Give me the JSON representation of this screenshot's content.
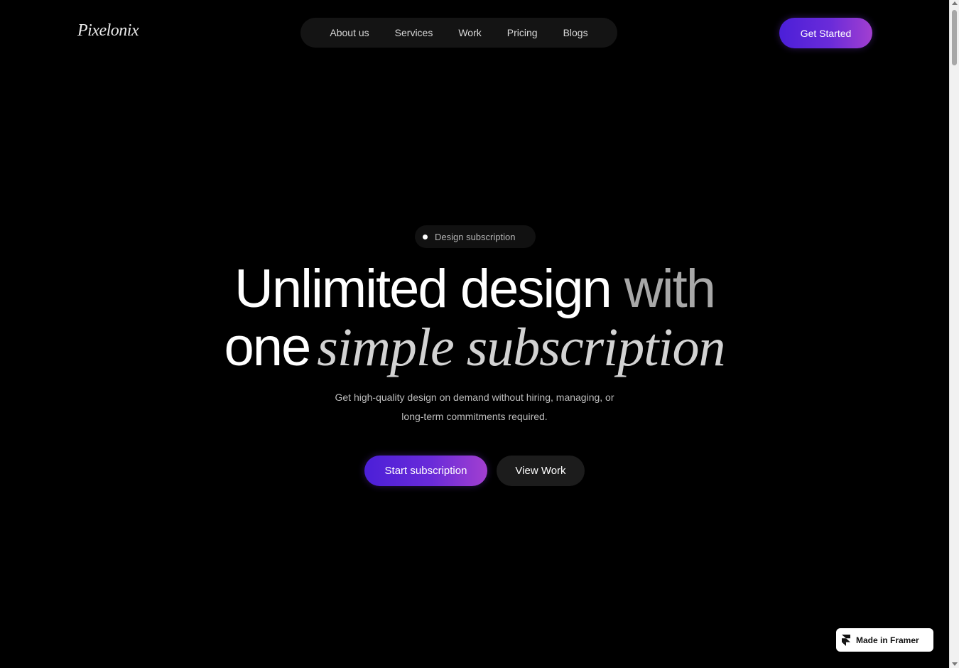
{
  "brand": {
    "logo": "Pixelonix"
  },
  "nav": {
    "items": [
      {
        "label": "About us"
      },
      {
        "label": "Services"
      },
      {
        "label": "Work"
      },
      {
        "label": "Pricing"
      },
      {
        "label": "Blogs"
      }
    ]
  },
  "header": {
    "cta_label": "Get Started"
  },
  "hero": {
    "badge": "Design subscription",
    "headline_line1_a": "Unlimited design",
    "headline_line1_b": "with",
    "headline_line2_a": "one",
    "headline_line2_b": "simple subscription",
    "subtext_line1": "Get high-quality design on demand without hiring, managing, or",
    "subtext_line2": "long-term commitments required.",
    "primary_cta": "Start subscription",
    "secondary_cta": "View Work"
  },
  "framer_badge": {
    "label": "Made in Framer",
    "icon": "framer-icon"
  },
  "colors": {
    "background": "#000000",
    "accent_start": "#4b1fd8",
    "accent_end": "#a23fd0",
    "nav_bg": "#141414"
  }
}
